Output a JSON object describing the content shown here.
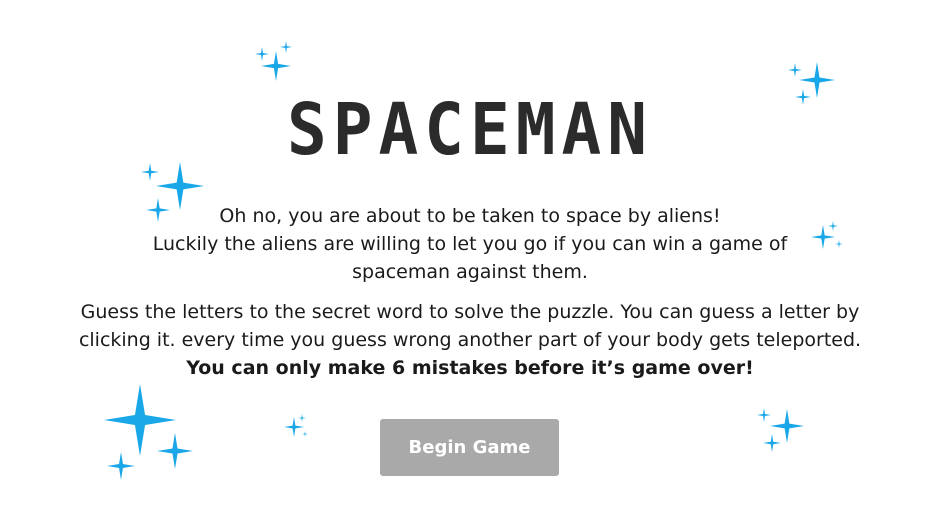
{
  "game": {
    "title": "SPACEMAN",
    "intro_line_1": "Oh no, you are about to be taken to space by aliens!",
    "intro_line_2": "Luckily the aliens are willing to let you go if you can win a game of spaceman against them.",
    "rules_text": "Guess the letters to the secret word to solve the puzzle. You can guess a letter by clicking it. every time you guess wrong another part of your body gets teleported.",
    "rules_warning": "You can only make 6 mistakes before it’s game over!",
    "begin_label": "Begin Game"
  },
  "colors": {
    "sparkle": "#1aa7e8",
    "title": "#2b2b2b",
    "button_bg": "#a9a9a9",
    "button_text": "#ffffff"
  }
}
